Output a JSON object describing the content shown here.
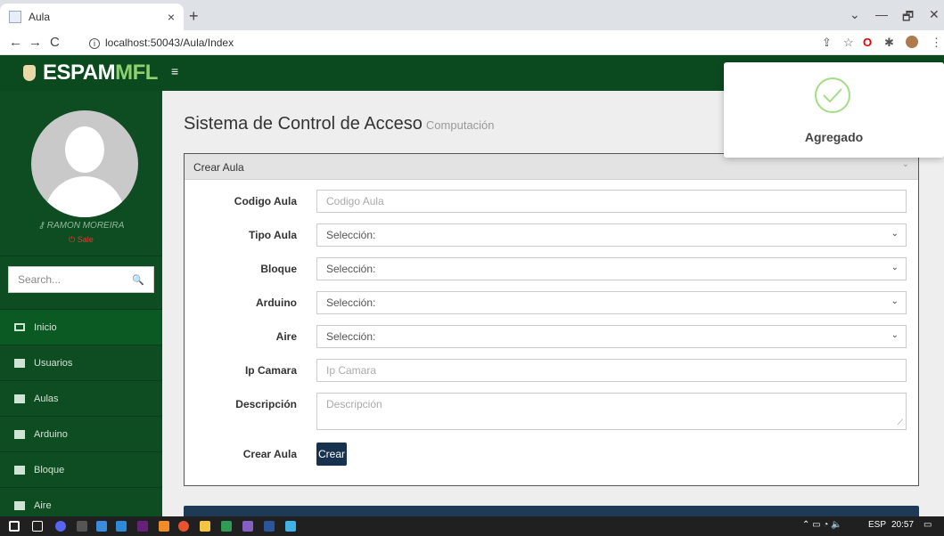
{
  "browser": {
    "tab_title": "Aula",
    "tab_close": "×",
    "new_tab": "+",
    "url": "localhost:50043/Aula/Index",
    "win_min": "—",
    "win_max": "🗗",
    "win_close": "✕",
    "chevron": "⌄"
  },
  "brand": {
    "part1": "ESPAM",
    "part2": "MFL"
  },
  "user": {
    "name": "RAMON MOREIRA",
    "logout": "Sale"
  },
  "sidebar": {
    "search_placeholder": "Search...",
    "items": [
      {
        "label": "Inicio",
        "icon": "monitor-icon"
      },
      {
        "label": "Usuarios",
        "icon": "table-icon"
      },
      {
        "label": "Aulas",
        "icon": "table-icon"
      },
      {
        "label": "Arduino",
        "icon": "table-icon"
      },
      {
        "label": "Bloque",
        "icon": "table-icon"
      },
      {
        "label": "Aire",
        "icon": "table-icon"
      }
    ]
  },
  "page": {
    "title": "Sistema de Control de Acceso",
    "subtitle": "Computación"
  },
  "form": {
    "header": "Crear Aula",
    "fields": [
      {
        "label": "Codigo Aula",
        "placeholder": "Codigo Aula"
      },
      {
        "label": "Tipo Aula",
        "value": "Selección:"
      },
      {
        "label": "Bloque",
        "value": "Selección:"
      },
      {
        "label": "Arduino",
        "value": "Selección:"
      },
      {
        "label": "Aire",
        "value": "Selección:"
      },
      {
        "label": "Ip Camara",
        "placeholder": "Ip Camara"
      },
      {
        "label": "Descripción",
        "placeholder": "Descripción"
      }
    ],
    "submit_label": "Crear Aula",
    "submit_button": "Crear"
  },
  "toast": {
    "message": "Agregado",
    "color": "#a5dc86"
  },
  "taskbar": {
    "lang": "ESP",
    "time": "20:57"
  }
}
